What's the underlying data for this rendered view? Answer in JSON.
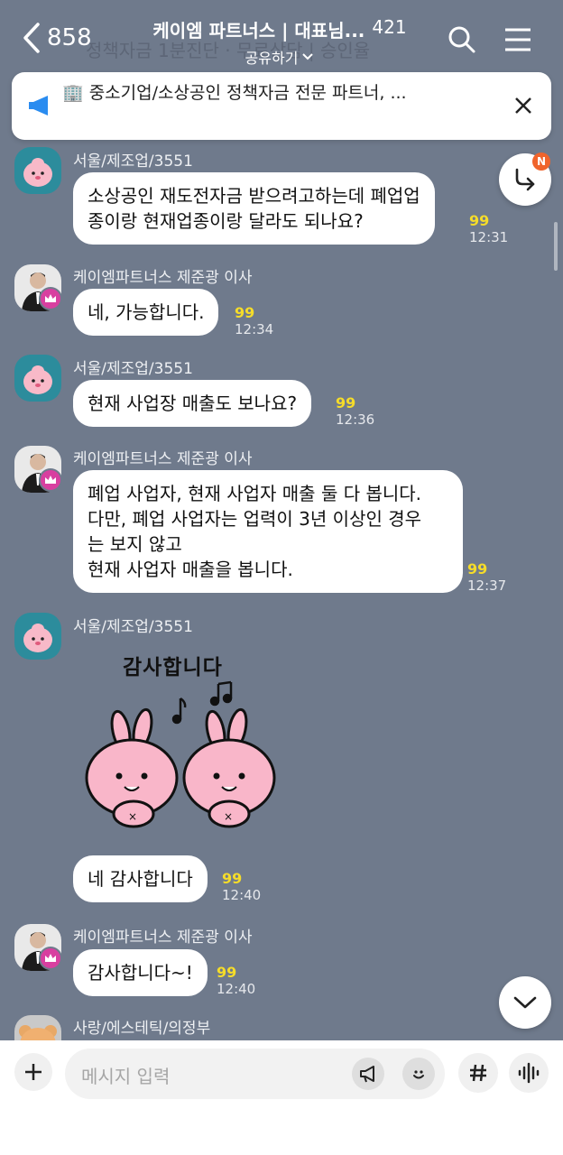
{
  "header": {
    "back_count": "858",
    "title": "케이엠 파트너스 | 대표님...",
    "member_count": "421",
    "share_label": "공유하기",
    "background_preview": "정책자금 1분진단 · 무료상담 | 승인율"
  },
  "notice": {
    "text": "🏢 중소기업/소상공인 정책자금 전문 파트너, ..."
  },
  "new_badge": "N",
  "messages": [
    {
      "sender": "서울/제조업/3551",
      "text": "소상공인 재도전자금 받으려고하는데 폐업업\n종이랑 현재업종이랑 달라도 되나요?",
      "unread": "99",
      "time": "12:31"
    },
    {
      "sender": "케이엠파트너스 제준광 이사",
      "text": "네, 가능합니다.",
      "unread": "99",
      "time": "12:34"
    },
    {
      "sender": "서울/제조업/3551",
      "text": "현재 사업장 매출도 보나요?",
      "unread": "99",
      "time": "12:36"
    },
    {
      "sender": "케이엠파트너스 제준광 이사",
      "text": "폐업 사업자, 현재 사업자 매출 둘 다 봅니다.\n다만, 폐업 사업자는 업력이 3년 이상인 경우\n는 보지 않고\n현재 사업자 매출을 봅니다.",
      "unread": "99",
      "time": "12:37"
    },
    {
      "sender": "서울/제조업/3551",
      "sticker_text": "감사합니다",
      "text": "네 감사합니다",
      "unread": "99",
      "time": "12:40"
    },
    {
      "sender": "케이엠파트너스 제준광 이사",
      "text": "감사합니다~!",
      "unread": "99",
      "time": "12:40"
    },
    {
      "sender": "사랑/에스테틱/의정부"
    }
  ],
  "input": {
    "placeholder": "메시지 입력"
  },
  "icons": {
    "back": "chevron-left-icon",
    "search": "search-icon",
    "menu": "hamburger-icon",
    "notice": "megaphone-icon",
    "close": "close-icon",
    "reply": "reply-arrow-icon",
    "scroll_down": "chevron-down-icon",
    "plus": "plus-icon",
    "announce": "megaphone-icon",
    "emoji": "smile-icon",
    "hashtag": "hashtag-icon",
    "voice": "waveform-icon"
  },
  "colors": {
    "chat_background": "#6f7a8c",
    "unread": "#f5dc2a",
    "notice_accent": "#2a8cf0",
    "crown_badge": "#d83fa0",
    "new_badge": "#f0642c"
  }
}
